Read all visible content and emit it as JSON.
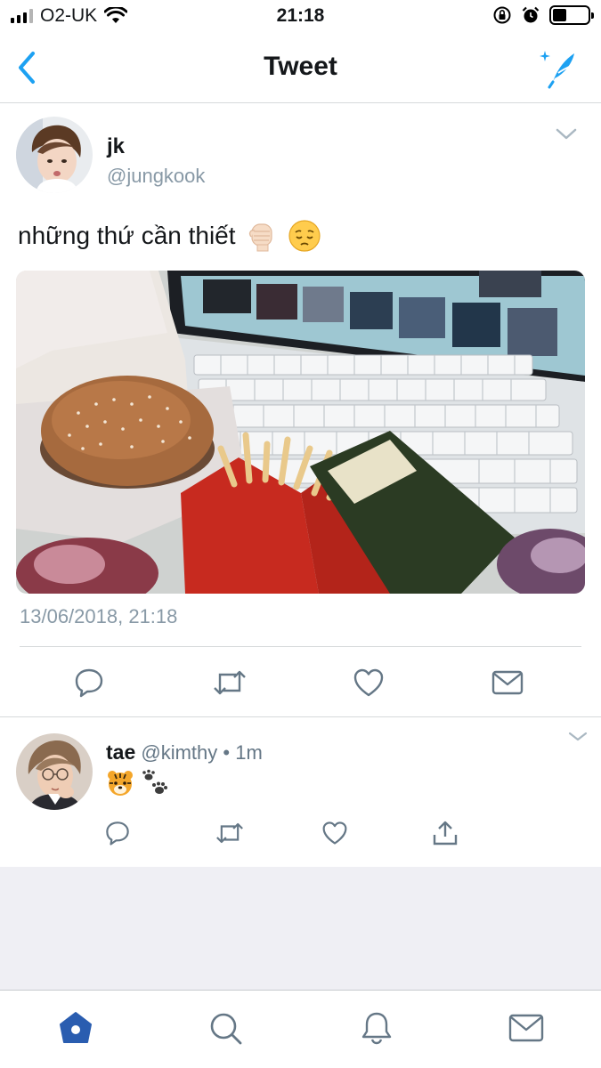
{
  "status": {
    "carrier": "O2-UK",
    "time": "21:18",
    "battery_level": 0.4
  },
  "nav": {
    "title": "Tweet",
    "back_icon": "chevron-left-icon",
    "compose_icon": "compose-feather-icon"
  },
  "tweet": {
    "author_name": "jk",
    "author_handle": "@jungkook",
    "text": "những thứ cần thiết",
    "emojis": [
      "raised-fist-emoji",
      "pensive-face-emoji"
    ],
    "timestamp": "13/06/2018, 21:18",
    "media_alt": "burger, fries and laptop",
    "actions": [
      "reply-icon",
      "retweet-icon",
      "like-icon",
      "direct-message-icon"
    ]
  },
  "reply": {
    "author_name": "tae",
    "author_handle": "@kimthy",
    "separator": "•",
    "time_ago": "1m",
    "emojis": [
      "tiger-face-emoji",
      "paw-prints-emoji"
    ],
    "actions": [
      "reply-icon",
      "retweet-icon",
      "like-icon",
      "share-icon"
    ]
  },
  "tab_bar": {
    "tabs": [
      "home-icon",
      "search-icon",
      "notifications-icon",
      "messages-icon"
    ],
    "active_tab": "home-icon"
  },
  "colors": {
    "accent": "#1da1f2",
    "tab_active": "#2a5db0",
    "icon_grey": "#657786",
    "muted_text": "#8899a6",
    "page_grey": "#efeff4"
  }
}
